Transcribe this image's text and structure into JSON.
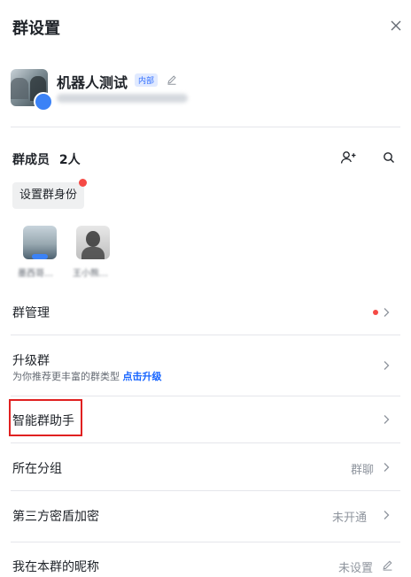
{
  "header": {
    "title": "群设置"
  },
  "group": {
    "name": "机器人测试",
    "tag": "内部"
  },
  "members": {
    "title": "群成员",
    "count": "2人",
    "set_role_label": "设置群身份",
    "list": [
      {
        "name": "墨西哥…"
      },
      {
        "name": "王小熊…"
      }
    ]
  },
  "rows": {
    "manage": {
      "label": "群管理"
    },
    "upgrade": {
      "label": "升级群",
      "sub": "为你推荐更丰富的群类型",
      "link": "点击升级"
    },
    "assistant": {
      "label": "智能群助手"
    },
    "group_folder": {
      "label": "所在分组",
      "value": "群聊"
    },
    "encryption": {
      "label": "第三方密盾加密",
      "value": "未开通"
    },
    "nickname": {
      "label": "我在本群的昵称",
      "value": "未设置"
    }
  },
  "colors": {
    "accent": "#1664ff",
    "alert": "#f54a45",
    "highlight_box": "#e02020"
  }
}
